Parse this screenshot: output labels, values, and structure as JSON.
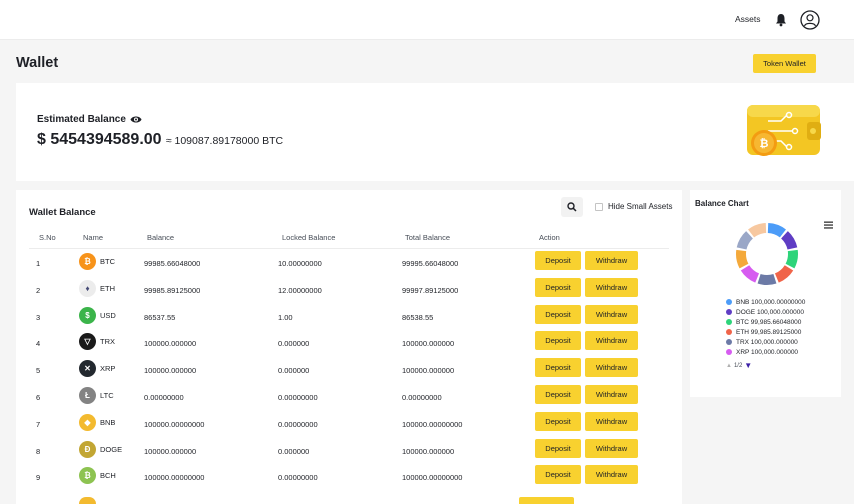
{
  "topbar": {
    "assets_label": "Assets",
    "bell_icon": "bell-icon",
    "avatar_icon": "user-icon"
  },
  "page": {
    "title": "Wallet",
    "token_wallet_label": "Token Wallet"
  },
  "balance": {
    "label": "Estimated Balance",
    "usd_value": "$ 5454394589.00",
    "btc_value": "≈ 109087.89178000 BTC"
  },
  "table": {
    "title": "Wallet Balance",
    "hide_small_label": "Hide Small Assets",
    "columns": [
      "S.No",
      "Name",
      "Balance",
      "Locked Balance",
      "Total Balance",
      "Action"
    ],
    "deposit_label": "Deposit",
    "withdraw_label": "Withdraw",
    "rows": [
      {
        "sno": "1",
        "name": "BTC",
        "balance": "99985.66048000",
        "locked": "10.00000000",
        "total": "99995.66048000",
        "icon": "btc-icon",
        "color": "#f7931a",
        "glyph": "₿"
      },
      {
        "sno": "2",
        "name": "ETH",
        "balance": "99985.89125000",
        "locked": "12.00000000",
        "total": "99997.89125000",
        "icon": "eth-icon",
        "color": "#ececec",
        "glyph": "♦"
      },
      {
        "sno": "3",
        "name": "USD",
        "balance": "86537.55",
        "locked": "1.00",
        "total": "86538.55",
        "icon": "usd-icon",
        "color": "#3bb44a",
        "glyph": "$"
      },
      {
        "sno": "4",
        "name": "TRX",
        "balance": "100000.000000",
        "locked": "0.000000",
        "total": "100000.000000",
        "icon": "trx-icon",
        "color": "#1a1a1a",
        "glyph": "▽"
      },
      {
        "sno": "5",
        "name": "XRP",
        "balance": "100000.000000",
        "locked": "0.000000",
        "total": "100000.000000",
        "icon": "xrp-icon",
        "color": "#23292f",
        "glyph": "✕"
      },
      {
        "sno": "6",
        "name": "LTC",
        "balance": "0.00000000",
        "locked": "0.00000000",
        "total": "0.00000000",
        "icon": "ltc-icon",
        "color": "#838383",
        "glyph": "Ł"
      },
      {
        "sno": "7",
        "name": "BNB",
        "balance": "100000.00000000",
        "locked": "0.00000000",
        "total": "100000.00000000",
        "icon": "bnb-icon",
        "color": "#f3ba2f",
        "glyph": "◆"
      },
      {
        "sno": "8",
        "name": "DOGE",
        "balance": "100000.000000",
        "locked": "0.000000",
        "total": "100000.000000",
        "icon": "doge-icon",
        "color": "#c2a633",
        "glyph": "Ð"
      },
      {
        "sno": "9",
        "name": "BCH",
        "balance": "100000.00000000",
        "locked": "0.00000000",
        "total": "100000.00000000",
        "icon": "bch-icon",
        "color": "#8dc351",
        "glyph": "₿"
      }
    ]
  },
  "chart": {
    "title": "Balance Chart",
    "menu_icon": "hamburger-menu-icon",
    "legend": [
      {
        "label": "BNB 100,000.00000000",
        "color": "#4c9cf8"
      },
      {
        "label": "DOGE 100,000.000000",
        "color": "#5f3dc4"
      },
      {
        "label": "BTC 99,985.66048000",
        "color": "#2ed47a"
      },
      {
        "label": "ETH 99,985.89125000",
        "color": "#f06449"
      },
      {
        "label": "TRX 100,000.000000",
        "color": "#6c7aa6"
      },
      {
        "label": "XRP 100,000.000000",
        "color": "#d65cf0"
      }
    ],
    "pager_text": "1/2"
  }
}
